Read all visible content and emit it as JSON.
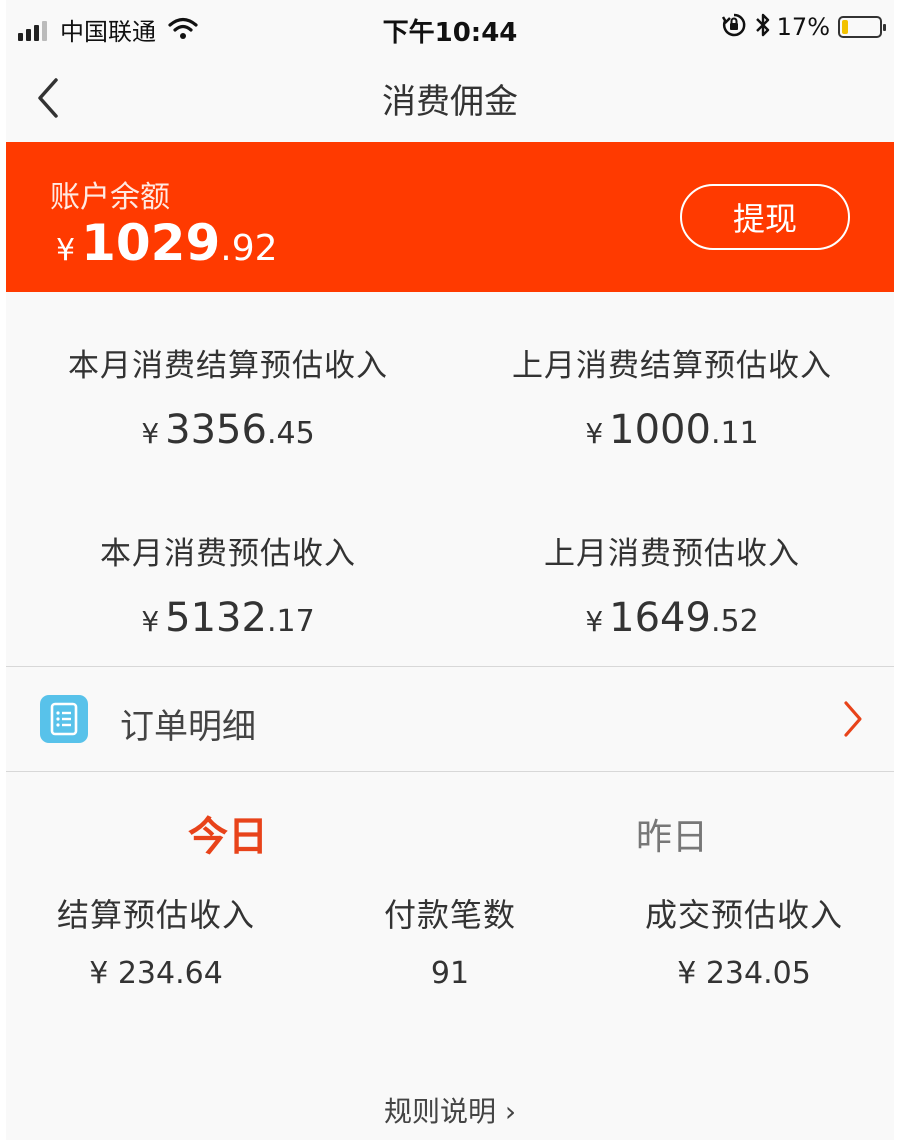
{
  "status_bar": {
    "carrier": "中国联通",
    "time": "下午10:44",
    "battery": "17%",
    "battery_level": 0.17,
    "icons": [
      "signal-icon",
      "wifi-icon",
      "rotation-lock-icon",
      "bluetooth-icon",
      "battery-icon"
    ]
  },
  "nav": {
    "title": "消费佣金",
    "back_icon": "chevron-left-icon"
  },
  "balance": {
    "label": "账户余额",
    "currency": "¥",
    "amount_int": "1029",
    "amount_dec": ".92",
    "withdraw_label": "提现",
    "background": "#ff3a00"
  },
  "stats": [
    {
      "label": "本月消费结算预估收入",
      "currency": "¥",
      "int": "3356",
      "dec": ".45"
    },
    {
      "label": "上月消费结算预估收入",
      "currency": "¥",
      "int": "1000",
      "dec": ".11"
    },
    {
      "label": "本月消费预估收入",
      "currency": "¥",
      "int": "5132",
      "dec": ".17"
    },
    {
      "label": "上月消费预估收入",
      "currency": "¥",
      "int": "1649",
      "dec": ".52"
    }
  ],
  "order_detail": {
    "label": "订单明细",
    "icon": "list-document-icon",
    "chevron": "chevron-right-icon",
    "icon_color": "#58c2ea",
    "chevron_color": "#e8431a"
  },
  "tabs": {
    "today": "今日",
    "yesterday": "昨日",
    "active": "today",
    "active_color": "#e8431a"
  },
  "daily": {
    "settle_label": "结算预估收入",
    "settle_value": "¥ 234.64",
    "payments_label": "付款笔数",
    "payments_value": "91",
    "deal_label": "成交预估收入",
    "deal_value": "¥ 234.05"
  },
  "rules": {
    "label": "规则说明 ›"
  }
}
